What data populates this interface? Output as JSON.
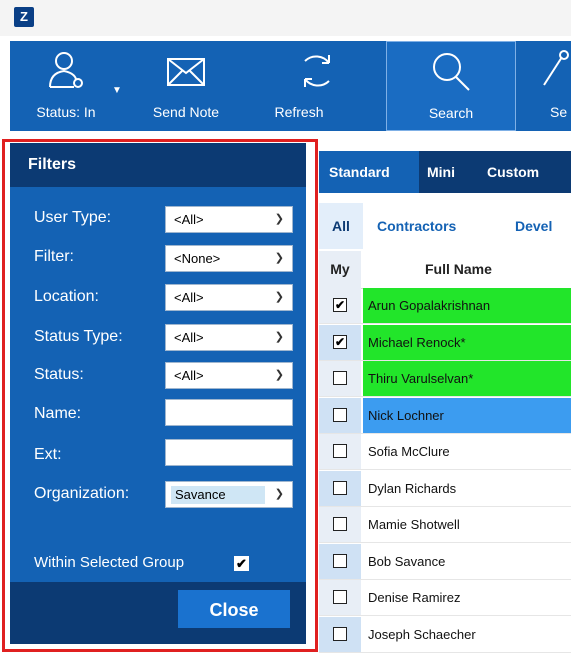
{
  "toolbar": {
    "status_label": "Status: In",
    "send_note_label": "Send Note",
    "refresh_label": "Refresh",
    "search_label": "Search",
    "partial_label": "Se"
  },
  "filters": {
    "title": "Filters",
    "user_type_label": "User Type:",
    "user_type_value": "<All>",
    "filter_label": "Filter:",
    "filter_value": "<None>",
    "location_label": "Location:",
    "location_value": "<All>",
    "status_type_label": "Status Type:",
    "status_type_value": "<All>",
    "status_label": "Status:",
    "status_value": "<All>",
    "name_label": "Name:",
    "name_value": "",
    "ext_label": "Ext:",
    "ext_value": "",
    "organization_label": "Organization:",
    "organization_value": "Savance",
    "within_group_label": "Within Selected Group",
    "within_group_checked": true,
    "close_label": "Close"
  },
  "view_tabs": [
    "Standard",
    "Mini",
    "Custom"
  ],
  "group_tabs": [
    "All",
    "Contractors",
    "Devel"
  ],
  "grid": {
    "col_my": "My",
    "col_name": "Full Name",
    "rows": [
      {
        "name": "Arun Gopalakrishnan",
        "checked": true,
        "color": "#22e52a"
      },
      {
        "name": "Michael Renock*",
        "checked": true,
        "color": "#22e52a"
      },
      {
        "name": "Thiru Varulselvan*",
        "checked": false,
        "color": "#22e52a"
      },
      {
        "name": "Nick Lochner",
        "checked": false,
        "color": "#3c9cf0"
      },
      {
        "name": "Sofia McClure",
        "checked": false,
        "color": ""
      },
      {
        "name": "Dylan Richards",
        "checked": false,
        "color": ""
      },
      {
        "name": "Mamie Shotwell",
        "checked": false,
        "color": ""
      },
      {
        "name": "Bob Savance",
        "checked": false,
        "color": ""
      },
      {
        "name": "Denise Ramirez",
        "checked": false,
        "color": ""
      },
      {
        "name": "Joseph Schaecher",
        "checked": false,
        "color": ""
      }
    ]
  },
  "colors": {
    "toolbar_blue": "#1462b4",
    "panel_dark": "#0c3a73",
    "highlight_red": "#e02020",
    "status_green": "#22e52a",
    "status_blue": "#3c9cf0"
  }
}
